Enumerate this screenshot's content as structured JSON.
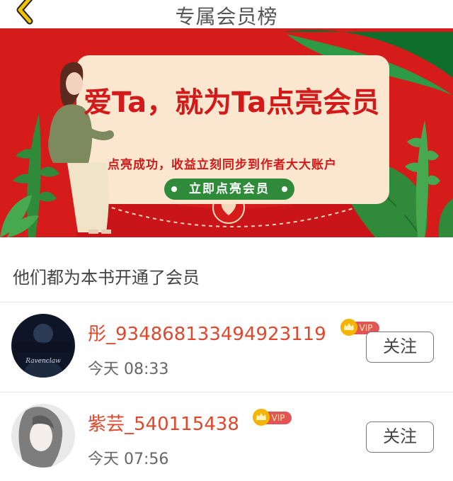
{
  "header": {
    "title": "专属会员榜",
    "back_icon": "chevron-left-icon",
    "accent_color": "#f2c200"
  },
  "banner": {
    "headline": "爱Ta，就为Ta点亮会员",
    "subline": "点亮成功，收益立刻同步到作者大大账户",
    "cta_label": "立即点亮会员",
    "colors": {
      "background": "#d61b1b",
      "card": "#fbe7cf",
      "leaf": "#2f8a3a"
    }
  },
  "section": {
    "title": "他们都为本书开通了会员"
  },
  "members": [
    {
      "name": "彤_934868133494923119",
      "badge": "VIP",
      "time": "今天 08:33",
      "follow_label": "关注",
      "avatar_text": "Ravenclaw"
    },
    {
      "name": "紫芸_540115438",
      "badge": "VIP",
      "time": "今天 07:56",
      "follow_label": "关注"
    }
  ]
}
